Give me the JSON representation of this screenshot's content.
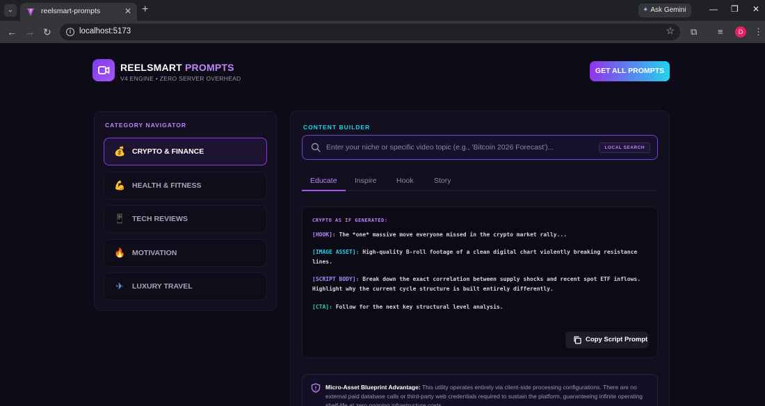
{
  "browser": {
    "tab_title": "reelsmart-prompts",
    "url": "localhost:5173",
    "gemini_label": "Ask Gemini",
    "profile_initial": "D"
  },
  "header": {
    "brand_main": "REELSMART",
    "brand_accent": "PROMPTS",
    "tagline": "V4 ENGINE • ZERO SERVER OVERHEAD",
    "cta_label": "GET ALL PROMPTS"
  },
  "sidebar": {
    "title": "CATEGORY NAVIGATOR",
    "items": [
      {
        "label": "CRYPTO & FINANCE",
        "icon": "money-bag-icon",
        "glyph": "💰",
        "active": true
      },
      {
        "label": "HEALTH & FITNESS",
        "icon": "flexed-bicep-icon",
        "glyph": "💪",
        "active": false
      },
      {
        "label": "TECH REVIEWS",
        "icon": "phone-icon",
        "glyph": "📱",
        "active": false
      },
      {
        "label": "MOTIVATION",
        "icon": "fire-icon",
        "glyph": "🔥",
        "active": false
      },
      {
        "label": "LUXURY TRAVEL",
        "icon": "airplane-icon",
        "glyph": "✈",
        "active": false
      }
    ]
  },
  "builder": {
    "title": "CONTENT BUILDER",
    "search_placeholder": "Enter your niche or specific video topic (e.g., 'Bitcoin 2026 Forecast')...",
    "search_badge": "LOCAL SEARCH",
    "tabs": [
      {
        "label": "Educate",
        "active": true
      },
      {
        "label": "Inspire",
        "active": false
      },
      {
        "label": "Hook",
        "active": false
      },
      {
        "label": "Story",
        "active": false
      }
    ],
    "output": {
      "title": "CRYPTO AS IF GENERATED:",
      "hook_tag": "[HOOK]:",
      "hook_text": " The *one* massive move everyone missed in the crypto market rally...",
      "asset_tag": "[IMAGE ASSET]:",
      "asset_text": " High-quality B-roll footage of a clean digital chart violently breaking resistance lines.",
      "body_tag": "[SCRIPT BODY]:",
      "body_text": " Break down the exact correlation between supply shocks and recent spot ETF inflows. Highlight why the current cycle structure is built entirely differently.",
      "cta_tag": "[CTA]:",
      "cta_text": " Follow for the next key structural level analysis.",
      "copy_label": "Copy Script Prompt"
    },
    "advantage": {
      "title": "Micro-Asset Blueprint Advantage:",
      "text": " This utility operates entirely via client-side processing configurations. There are no external paid database calls or third-party web credentials required to sustain the platform, guaranteeing infinite operating shelf-life at zero ongoing infrastructure costs."
    }
  },
  "colors": {
    "accent_purple": "#a855f7",
    "accent_cyan": "#22d3ee",
    "background": "#0e0b18"
  }
}
